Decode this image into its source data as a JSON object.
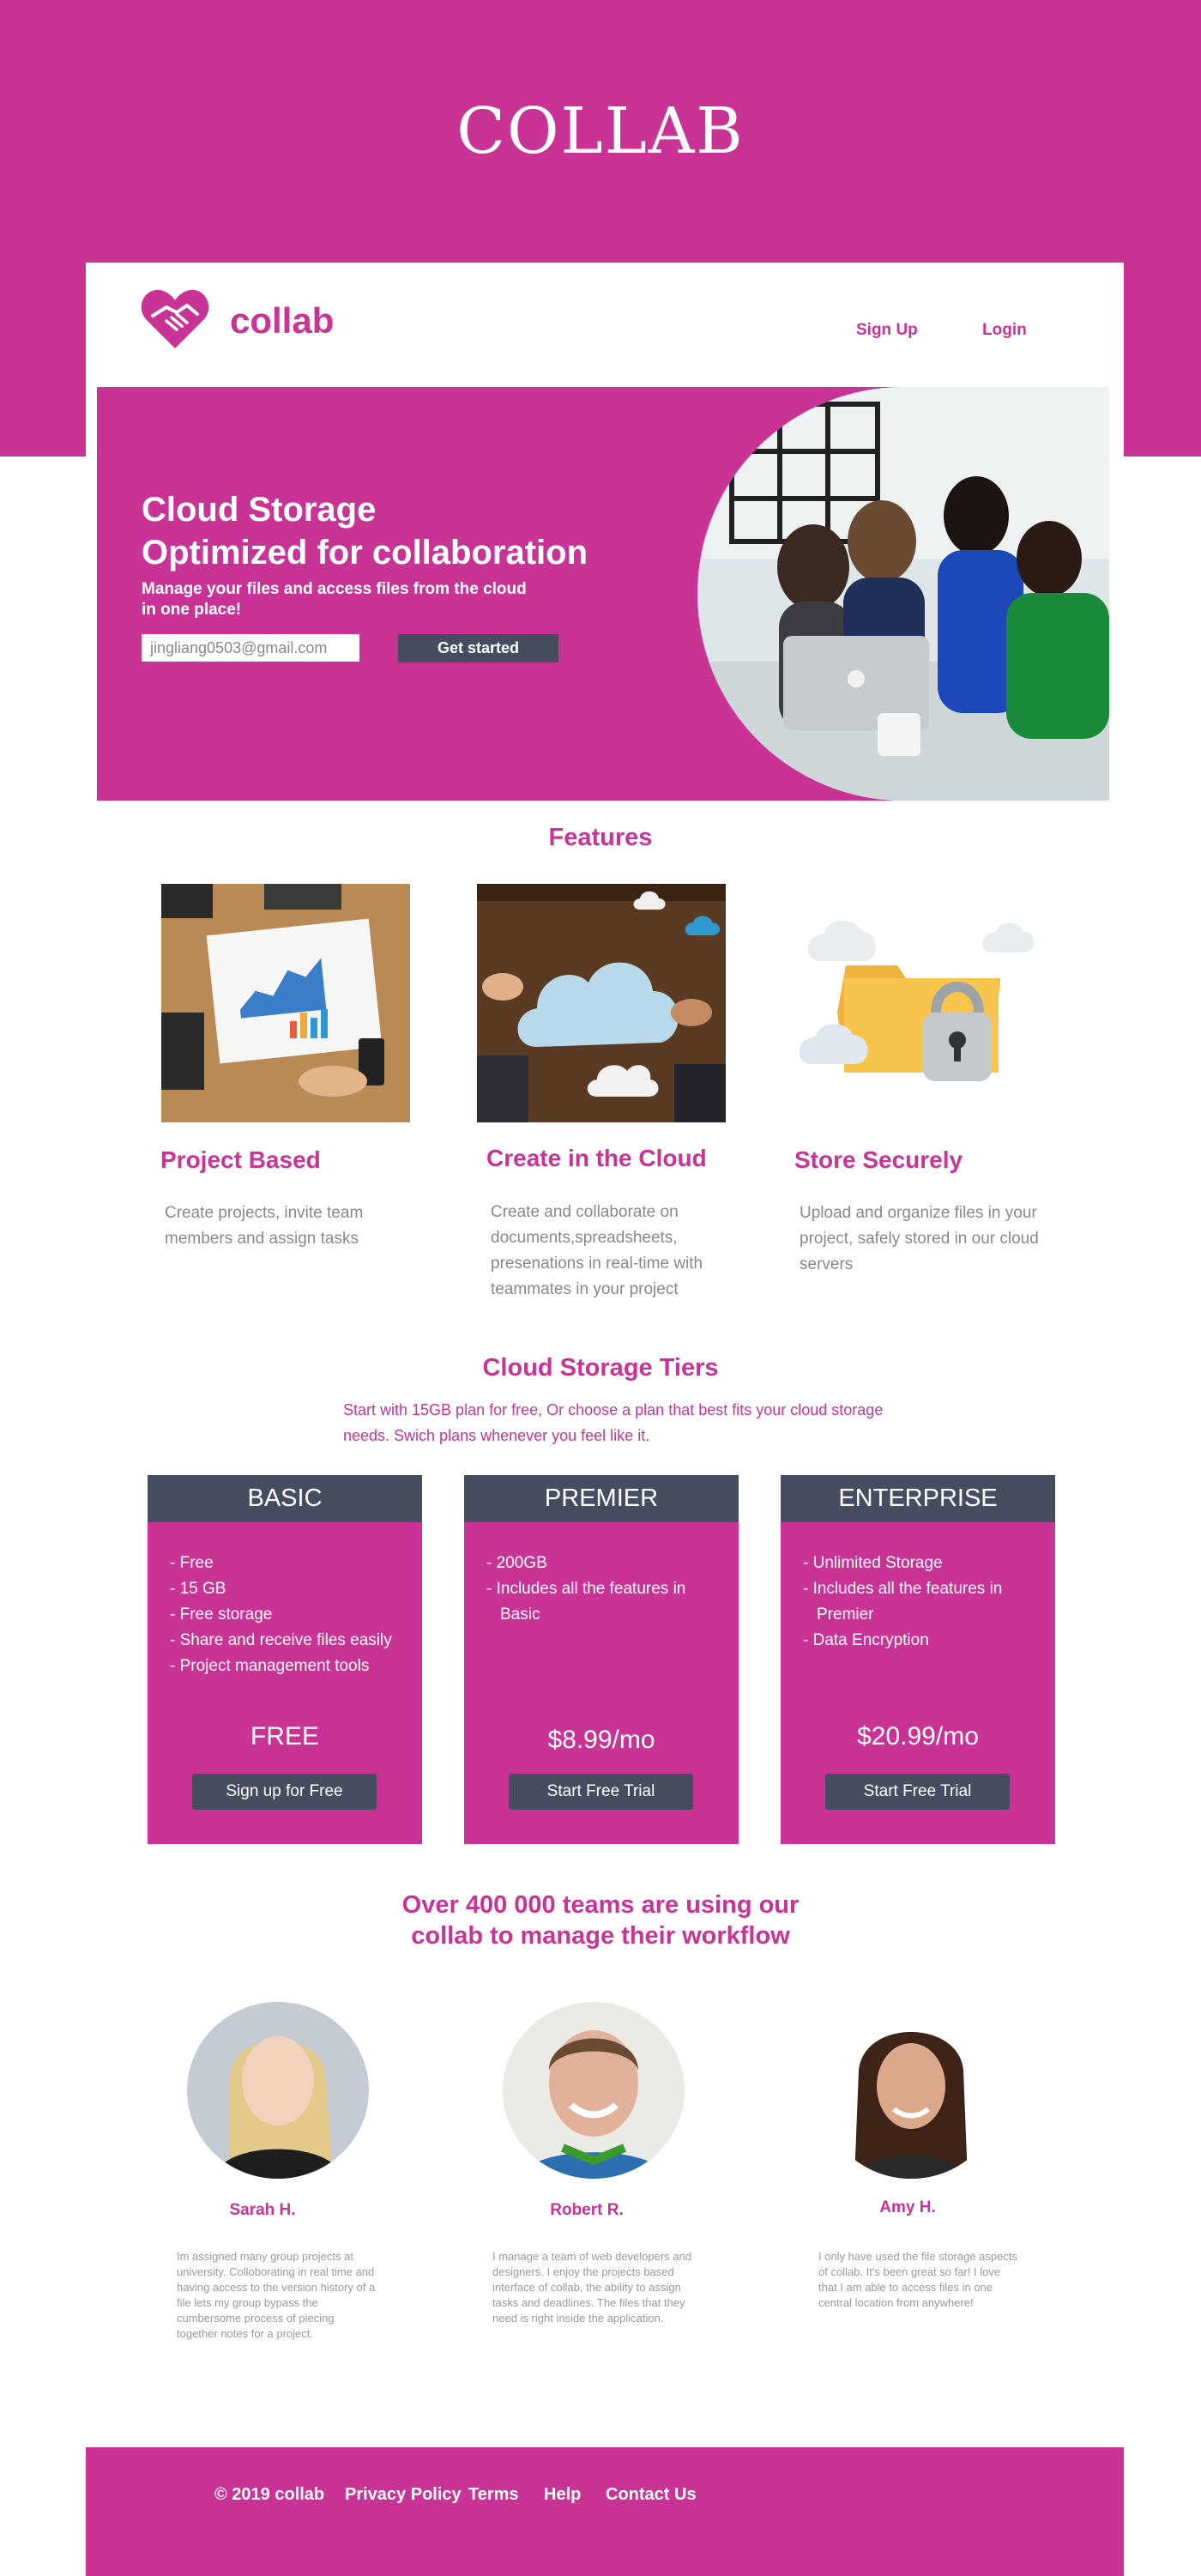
{
  "header": {
    "brand_title": "COLLAB"
  },
  "nav": {
    "logo_text": "collab",
    "signup": "Sign Up",
    "login": "Login"
  },
  "hero": {
    "title_line1": "Cloud Storage",
    "title_line2": "Optimized for collaboration",
    "subtitle": "Manage your files and access files from the cloud in one place!",
    "email_value": "jingliang0503@gmail.com",
    "cta": "Get started"
  },
  "features": {
    "title": "Features",
    "items": [
      {
        "title": "Project Based",
        "desc": "Create projects, invite team members and assign tasks"
      },
      {
        "title": "Create in the Cloud",
        "desc": "Create and collaborate on documents,spreadsheets, presenations  in real-time with teammates in your project"
      },
      {
        "title": "Store Securely",
        "desc": "Upload and organize files in your project, safely stored in our cloud servers"
      }
    ]
  },
  "tiers": {
    "title": "Cloud Storage Tiers",
    "intro": "Start with 15GB plan for free, Or choose a plan that best fits your cloud storage needs. Swich plans whenever you feel like it.",
    "plans": [
      {
        "name": "BASIC",
        "features": [
          "- Free",
          "- 15 GB",
          "- Free storage",
          "- Share and receive files easily",
          "- Project management tools"
        ],
        "price": "FREE",
        "button": "Sign up for Free"
      },
      {
        "name": "PREMIER",
        "features": [
          "- 200GB",
          "- Includes all the features in Basic"
        ],
        "price": "$8.99/mo",
        "button": "Start Free Trial"
      },
      {
        "name": "ENTERPRISE",
        "features": [
          "- Unlimited Storage",
          "- Includes all the features in Premier",
          "- Data Encryption"
        ],
        "price": "$20.99/mo",
        "button": "Start Free Trial"
      }
    ]
  },
  "testimonials": {
    "title_line1": "Over 400 000 teams are using our",
    "title_line2": "collab to manage their workflow",
    "items": [
      {
        "name": "Sarah H.",
        "quote": "Im assigned many group projects at university. Colloborating in real time and having access to the version history of a file lets my group bypass the cumbersome process of piecing together notes for a project."
      },
      {
        "name": "Robert R.",
        "quote": "I manage a team of web developers and designers.  I enjoy the projects based interface of collab, the ability to assign tasks and deadlines. The files that they need is right inside the application."
      },
      {
        "name": "Amy H.",
        "quote": "I only have used the file storage aspects of collab. It's been great so far! I love that I am able to access files in one central location from anywhere!"
      }
    ]
  },
  "footer": {
    "copyright": "© 2019  collab",
    "privacy": "Privacy Policy",
    "terms": "Terms",
    "help": "Help",
    "contact": "Contact Us"
  },
  "colors": {
    "brand": "#c93395",
    "dark": "#474d60"
  }
}
